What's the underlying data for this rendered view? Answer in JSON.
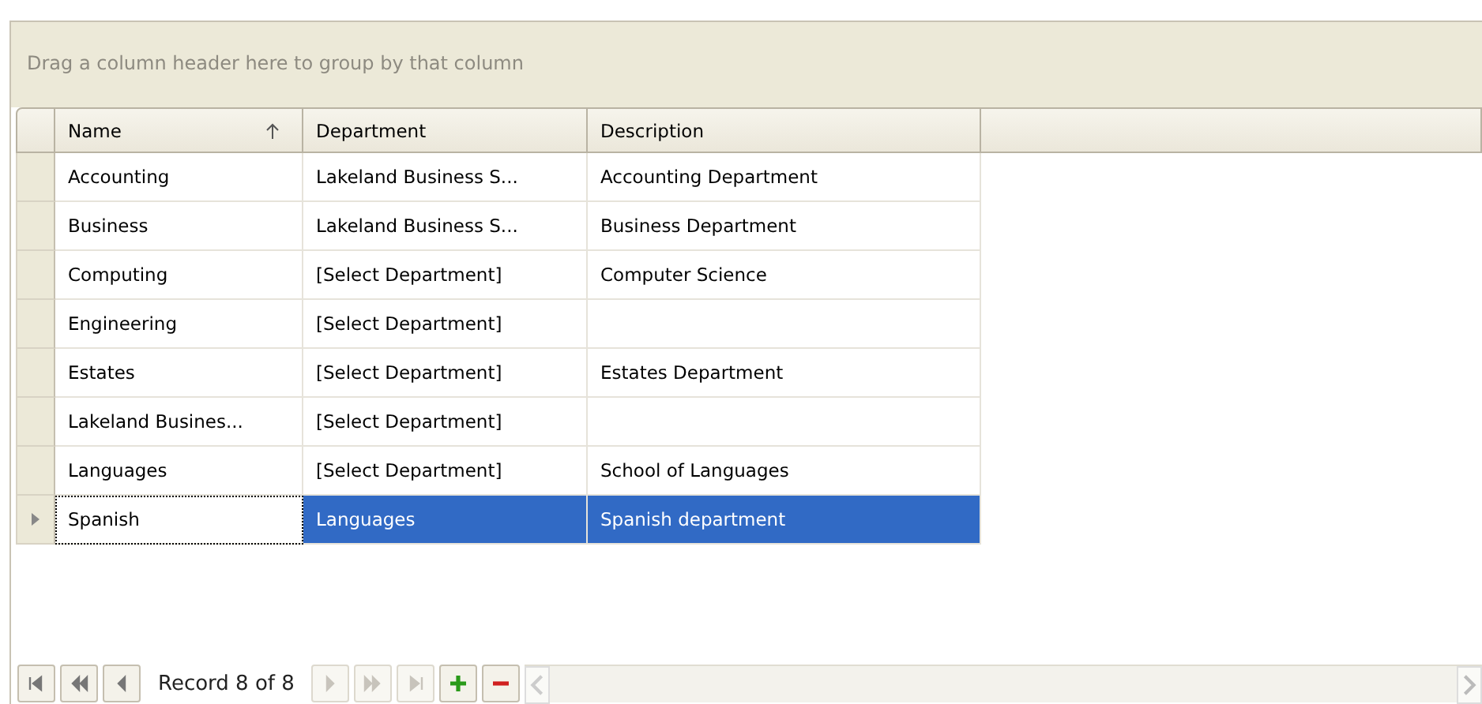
{
  "group_panel": {
    "placeholder": "Drag a column header here to group by that column"
  },
  "table": {
    "columns": [
      {
        "label": "Name",
        "sorted": true
      },
      {
        "label": "Department",
        "sorted": false
      },
      {
        "label": "Description",
        "sorted": false
      }
    ],
    "rows": [
      {
        "cells": [
          "Accounting",
          "Lakeland Business S...",
          "Accounting Department"
        ],
        "selected": false
      },
      {
        "cells": [
          "Business",
          "Lakeland Business S...",
          "Business Department"
        ],
        "selected": false
      },
      {
        "cells": [
          "Computing",
          "[Select Department]",
          "Computer Science"
        ],
        "selected": false
      },
      {
        "cells": [
          "Engineering",
          "[Select Department]",
          ""
        ],
        "selected": false
      },
      {
        "cells": [
          "Estates",
          "[Select Department]",
          "Estates Department"
        ],
        "selected": false
      },
      {
        "cells": [
          "Lakeland Busines...",
          "[Select Department]",
          ""
        ],
        "selected": false
      },
      {
        "cells": [
          "Languages",
          "[Select Department]",
          "School of Languages"
        ],
        "selected": false
      },
      {
        "cells": [
          "Spanish",
          "Languages",
          "Spanish department"
        ],
        "selected": true
      }
    ]
  },
  "navigator": {
    "buttons": [
      {
        "kind": "first",
        "disabled": false
      },
      {
        "kind": "prev-page",
        "disabled": false
      },
      {
        "kind": "prev",
        "disabled": false
      },
      {
        "kind": "next",
        "disabled": true
      },
      {
        "kind": "next-page",
        "disabled": true
      },
      {
        "kind": "last",
        "disabled": true
      },
      {
        "kind": "add",
        "disabled": false
      },
      {
        "kind": "remove",
        "disabled": false
      }
    ],
    "record": "Record 8 of 8"
  }
}
